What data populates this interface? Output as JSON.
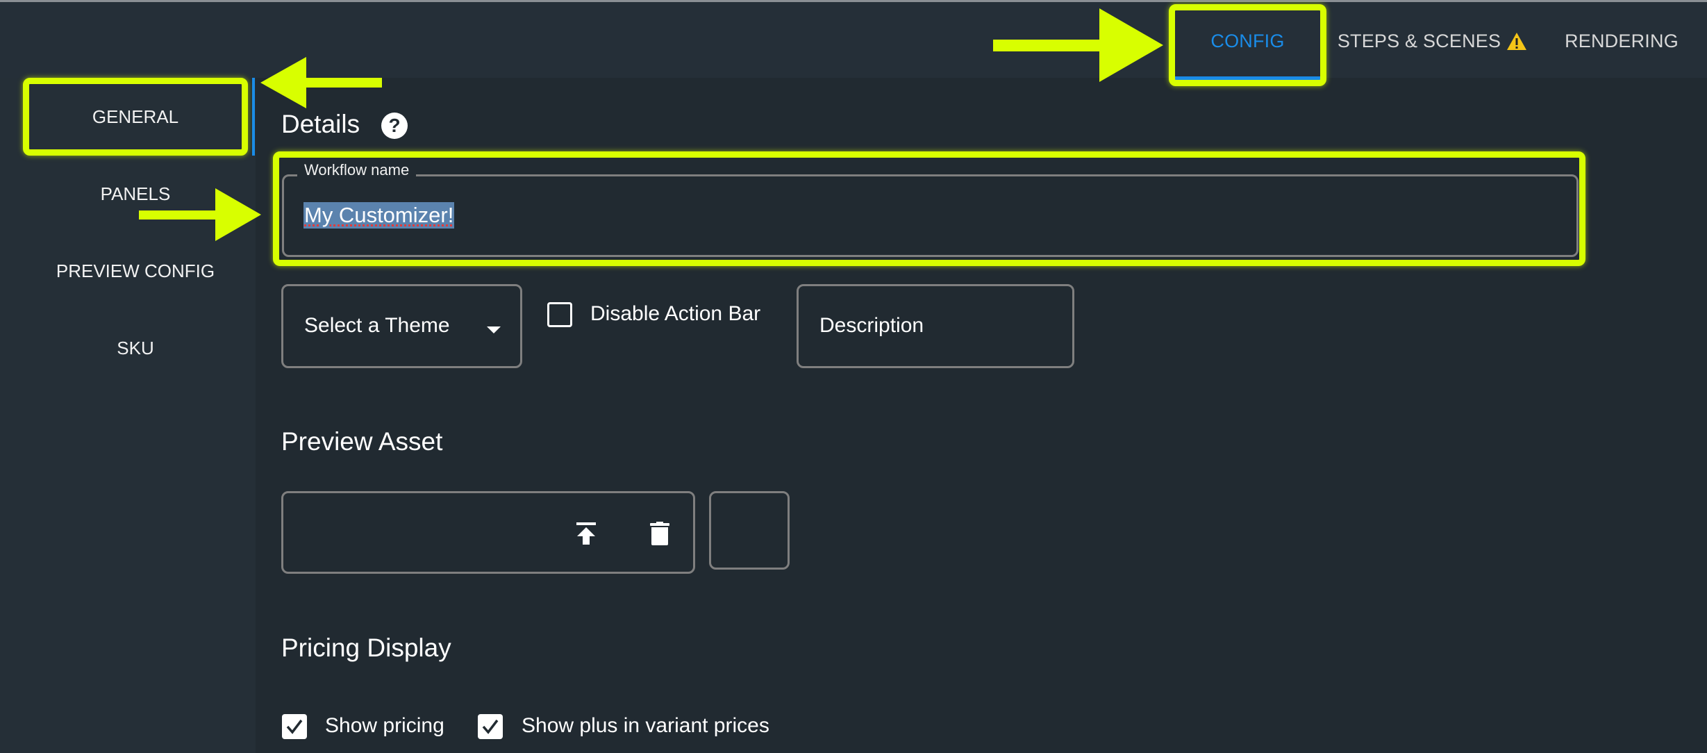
{
  "tabs": [
    {
      "label": "CONFIG",
      "active": true
    },
    {
      "label": "STEPS & SCENES",
      "warning": true,
      "warning_icon": "warning-triangle-icon"
    },
    {
      "label": "RENDERING",
      "active": false
    }
  ],
  "sidebar": {
    "items": [
      {
        "label": "GENERAL",
        "active": true
      },
      {
        "label": "PANELS"
      },
      {
        "label": "PREVIEW CONFIG"
      },
      {
        "label": "SKU"
      }
    ]
  },
  "details": {
    "title": "Details",
    "help_icon": "help-circle-icon",
    "workflow_name": {
      "label": "Workflow name",
      "value": "My Customizer!",
      "selected": true
    },
    "theme_select": {
      "placeholder": "Select a Theme"
    },
    "disable_action_bar": {
      "label": "Disable Action Bar",
      "checked": false
    },
    "description": {
      "placeholder": "Description"
    }
  },
  "preview_asset": {
    "title": "Preview Asset",
    "upload_icon": "upload-icon",
    "delete_icon": "trash-icon"
  },
  "pricing_display": {
    "title": "Pricing Display",
    "options": [
      {
        "label": "Show pricing",
        "checked": true
      },
      {
        "label": "Show plus in variant prices",
        "checked": true
      }
    ]
  },
  "colors": {
    "accent": "#1a8ce8",
    "highlight": "#d8ff00",
    "warning": "#f5c518",
    "background": "#212a31",
    "sidebar": "#252f37"
  }
}
